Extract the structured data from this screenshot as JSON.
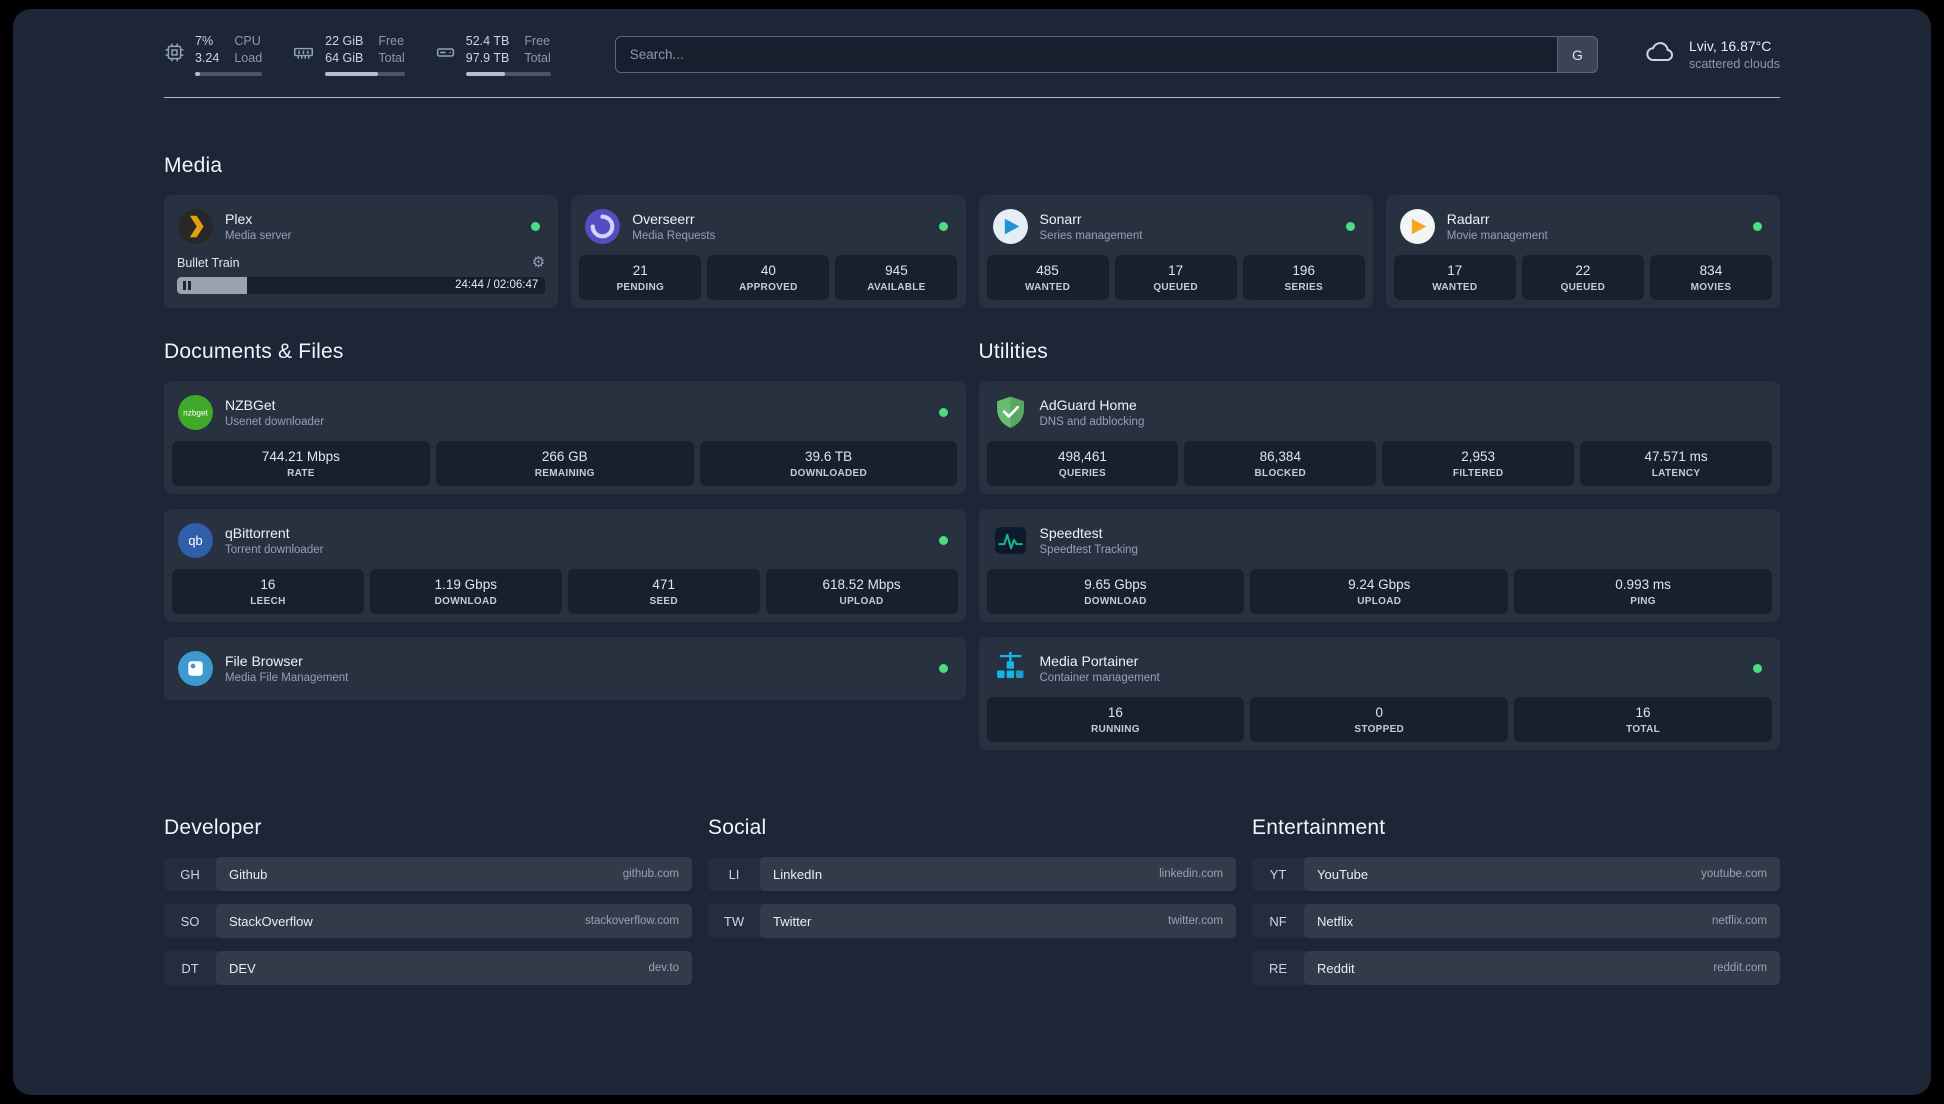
{
  "colors": {
    "panel-bg": "#1d2636",
    "status-online": "#4ade80",
    "plex-amber": "#e5a00d",
    "overseerr-purple": "#554ec0",
    "sonarr-blue": "#2193d1",
    "radarr-amber": "#f5a623",
    "nzbget-green": "#3faa2a",
    "qbittorrent-blue": "#2f5fa8",
    "filebrowser-blue": "#3d9ad1",
    "adguard-green": "#68bc71",
    "speedtest-green": "#10b981",
    "portainer-blue": "#13b5ea"
  },
  "icons": {
    "gear": "⚙"
  },
  "topbar": {
    "cpu": {
      "icon": "cpu-icon",
      "value1": "7%",
      "value2": "3.24",
      "label1": "CPU",
      "label2": "Load",
      "bar_percent": 7
    },
    "memory": {
      "icon": "memory-icon",
      "value1": "22 GiB",
      "value2": "64 GiB",
      "label1": "Free",
      "label2": "Total",
      "bar_percent": 66
    },
    "disk": {
      "icon": "disk-icon",
      "value1": "52.4 TB",
      "value2": "97.9 TB",
      "label1": "Free",
      "label2": "Total",
      "bar_percent": 46
    },
    "search": {
      "placeholder": "Search...",
      "provider": "G"
    },
    "weather": {
      "icon": "cloud-icon",
      "location": "Lviv, 16.87°C",
      "condition": "scattered clouds"
    }
  },
  "groups": {
    "media": {
      "title": "Media",
      "services": [
        {
          "name": "Plex",
          "subtitle": "Media server",
          "icon": "plex-icon",
          "online": true,
          "player": {
            "title": "Bullet Train",
            "time": "24:44 / 02:06:47",
            "progress_percent": 19
          }
        },
        {
          "name": "Overseerr",
          "subtitle": "Media Requests",
          "icon": "overseerr-icon",
          "online": true,
          "stats": [
            {
              "value": "21",
              "label": "PENDING"
            },
            {
              "value": "40",
              "label": "APPROVED"
            },
            {
              "value": "945",
              "label": "AVAILABLE"
            }
          ]
        },
        {
          "name": "Sonarr",
          "subtitle": "Series management",
          "icon": "sonarr-icon",
          "online": true,
          "stats": [
            {
              "value": "485",
              "label": "WANTED"
            },
            {
              "value": "17",
              "label": "QUEUED"
            },
            {
              "value": "196",
              "label": "SERIES"
            }
          ]
        },
        {
          "name": "Radarr",
          "subtitle": "Movie management",
          "icon": "radarr-icon",
          "online": true,
          "stats": [
            {
              "value": "17",
              "label": "WANTED"
            },
            {
              "value": "22",
              "label": "QUEUED"
            },
            {
              "value": "834",
              "label": "MOVIES"
            }
          ]
        }
      ]
    },
    "documents": {
      "title": "Documents & Files",
      "services": [
        {
          "name": "NZBGet",
          "subtitle": "Usenet downloader",
          "icon": "nzbget-icon",
          "icon_text": "nzbget",
          "online": true,
          "stats": [
            {
              "value": "744.21 Mbps",
              "label": "RATE"
            },
            {
              "value": "266 GB",
              "label": "REMAINING"
            },
            {
              "value": "39.6 TB",
              "label": "DOWNLOADED"
            }
          ]
        },
        {
          "name": "qBittorrent",
          "subtitle": "Torrent downloader",
          "icon": "qbittorrent-icon",
          "icon_text": "qb",
          "online": true,
          "stats": [
            {
              "value": "16",
              "label": "LEECH"
            },
            {
              "value": "1.19 Gbps",
              "label": "DOWNLOAD"
            },
            {
              "value": "471",
              "label": "SEED"
            },
            {
              "value": "618.52 Mbps",
              "label": "UPLOAD"
            }
          ]
        },
        {
          "name": "File Browser",
          "subtitle": "Media File Management",
          "icon": "filebrowser-icon",
          "online": true
        }
      ]
    },
    "utilities": {
      "title": "Utilities",
      "services": [
        {
          "name": "AdGuard Home",
          "subtitle": "DNS and adblocking",
          "icon": "adguard-icon",
          "stats": [
            {
              "value": "498,461",
              "label": "QUERIES"
            },
            {
              "value": "86,384",
              "label": "BLOCKED"
            },
            {
              "value": "2,953",
              "label": "FILTERED"
            },
            {
              "value": "47.571 ms",
              "label": "LATENCY"
            }
          ]
        },
        {
          "name": "Speedtest",
          "subtitle": "Speedtest Tracking",
          "icon": "speedtest-icon",
          "stats": [
            {
              "value": "9.65 Gbps",
              "label": "DOWNLOAD"
            },
            {
              "value": "9.24 Gbps",
              "label": "UPLOAD"
            },
            {
              "value": "0.993 ms",
              "label": "PING"
            }
          ]
        },
        {
          "name": "Media Portainer",
          "subtitle": "Container management",
          "icon": "portainer-icon",
          "online": true,
          "stats": [
            {
              "value": "16",
              "label": "RUNNING"
            },
            {
              "value": "0",
              "label": "STOPPED"
            },
            {
              "value": "16",
              "label": "TOTAL"
            }
          ]
        }
      ]
    }
  },
  "bookmarks": [
    {
      "title": "Developer",
      "items": [
        {
          "abbr": "GH",
          "name": "Github",
          "domain": "github.com"
        },
        {
          "abbr": "SO",
          "name": "StackOverflow",
          "domain": "stackoverflow.com"
        },
        {
          "abbr": "DT",
          "name": "DEV",
          "domain": "dev.to"
        }
      ]
    },
    {
      "title": "Social",
      "items": [
        {
          "abbr": "LI",
          "name": "LinkedIn",
          "domain": "linkedin.com"
        },
        {
          "abbr": "TW",
          "name": "Twitter",
          "domain": "twitter.com"
        }
      ]
    },
    {
      "title": "Entertainment",
      "items": [
        {
          "abbr": "YT",
          "name": "YouTube",
          "domain": "youtube.com"
        },
        {
          "abbr": "NF",
          "name": "Netflix",
          "domain": "netflix.com"
        },
        {
          "abbr": "RE",
          "name": "Reddit",
          "domain": "reddit.com"
        }
      ]
    }
  ]
}
